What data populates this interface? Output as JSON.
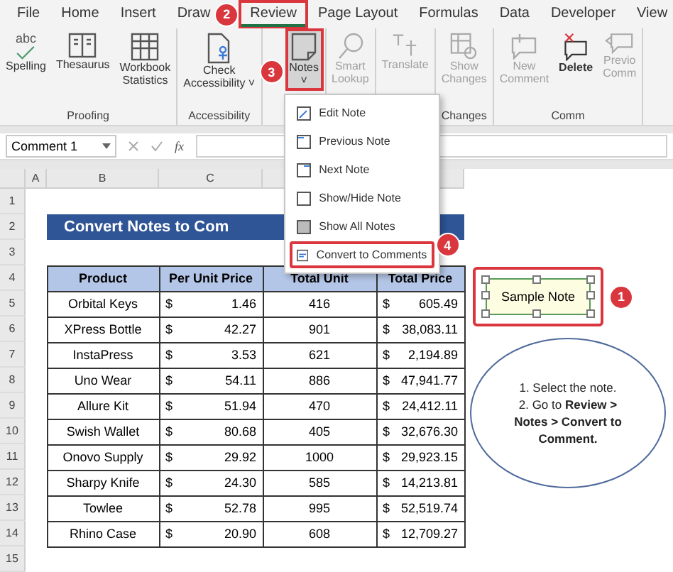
{
  "tabs": [
    {
      "label": "File",
      "selected": false,
      "highlighted": false
    },
    {
      "label": "Home",
      "selected": false,
      "highlighted": false
    },
    {
      "label": "Insert",
      "selected": false,
      "highlighted": false
    },
    {
      "label": "Draw",
      "selected": false,
      "highlighted": false
    },
    {
      "label": "Review",
      "selected": true,
      "highlighted": true,
      "callout": "2"
    },
    {
      "label": "Page Layout",
      "selected": false,
      "highlighted": false
    },
    {
      "label": "Formulas",
      "selected": false,
      "highlighted": false
    },
    {
      "label": "Data",
      "selected": false,
      "highlighted": false
    },
    {
      "label": "Developer",
      "selected": false,
      "highlighted": false
    },
    {
      "label": "View",
      "selected": false,
      "highlighted": false
    }
  ],
  "ribbon_groups": [
    {
      "label": "Proofing",
      "buttons": [
        {
          "icon_text": "abc",
          "lines": [
            "Spelling"
          ],
          "disabled": false,
          "highlighted": false
        },
        {
          "lines": [
            "Thesaurus"
          ],
          "disabled": false,
          "highlighted": false
        },
        {
          "lines": [
            "Workbook",
            "Statistics"
          ],
          "disabled": false,
          "highlighted": false
        }
      ]
    },
    {
      "label": "Accessibility",
      "buttons": [
        {
          "lines": [
            "Check",
            "Accessibility ˅"
          ],
          "disabled": false,
          "highlighted": false
        }
      ]
    },
    {
      "buttons": [
        {
          "lines": [
            "Notes",
            "˅"
          ],
          "disabled": false,
          "highlighted": true,
          "callout": "3",
          "menu": [
            {
              "label": "Edit Note",
              "highlighted": false
            },
            {
              "label": "Previous Note",
              "highlighted": false
            },
            {
              "label": "Next Note",
              "highlighted": false
            },
            {
              "label": "Show/Hide Note",
              "highlighted": false
            },
            {
              "label": "Show All Notes",
              "highlighted": false
            },
            {
              "label": "Convert to Comments",
              "highlighted": true,
              "callout": "4"
            }
          ]
        }
      ]
    },
    {
      "buttons": [
        {
          "lines": [
            "Smart",
            "Lookup"
          ],
          "disabled": true,
          "highlighted": false
        }
      ]
    },
    {
      "buttons": [
        {
          "lines": [
            "Translate"
          ],
          "disabled": true,
          "highlighted": false
        }
      ]
    },
    {
      "label": "Changes",
      "buttons": [
        {
          "lines": [
            "Show",
            "Changes"
          ],
          "disabled": true,
          "highlighted": false
        }
      ]
    },
    {
      "label": "Comm",
      "buttons": [
        {
          "lines": [
            "New",
            "Comment"
          ],
          "disabled": true,
          "highlighted": false
        },
        {
          "lines": [
            "Delete"
          ],
          "disabled": false,
          "highlighted": false
        },
        {
          "lines": [
            "Previo",
            "Comm"
          ],
          "disabled": true,
          "highlighted": false
        }
      ]
    }
  ],
  "formula_bar": {
    "name_box": "Comment 1",
    "function_label": "fx"
  },
  "column_headers": [
    "A",
    "B",
    "C"
  ],
  "row_headers": [
    "1",
    "2",
    "3",
    "4",
    "5",
    "6",
    "7",
    "8",
    "9",
    "10",
    "11",
    "12",
    "13",
    "14",
    "15"
  ],
  "sheet_title": "Convert Notes to Com",
  "table": {
    "columns": [
      "Product",
      "Per Unit Price",
      "Total Unit",
      "Total Price"
    ],
    "rows": [
      {
        "product": "Orbital Keys",
        "unit_price": "1.46",
        "total_unit": "416",
        "total_price": "605.49",
        "currency": "$",
        "currency_2": "$"
      },
      {
        "product": "XPress Bottle",
        "unit_price": "42.27",
        "total_unit": "901",
        "total_price": "38,083.11",
        "currency": "$",
        "currency_2": "$"
      },
      {
        "product": "InstaPress",
        "unit_price": "3.53",
        "total_unit": "621",
        "total_price": "2,194.89",
        "currency": "$",
        "currency_2": "$"
      },
      {
        "product": "Uno Wear",
        "unit_price": "54.11",
        "total_unit": "886",
        "total_price": "47,941.77",
        "currency": "$",
        "currency_2": "$"
      },
      {
        "product": "Allure Kit",
        "unit_price": "51.94",
        "total_unit": "470",
        "total_price": "24,412.11",
        "currency": "$",
        "currency_2": "$"
      },
      {
        "product": "Swish Wallet",
        "unit_price": "80.68",
        "total_unit": "405",
        "total_price": "32,676.30",
        "currency": "$",
        "currency_2": "$"
      },
      {
        "product": "Onovo Supply",
        "unit_price": "29.92",
        "total_unit": "1000",
        "total_price": "29,923.15",
        "currency": "$",
        "currency_2": "$"
      },
      {
        "product": "Sharpy Knife",
        "unit_price": "24.30",
        "total_unit": "585",
        "total_price": "14,213.81",
        "currency": "$",
        "currency_2": "$"
      },
      {
        "product": "Towlee",
        "unit_price": "52.78",
        "total_unit": "995",
        "total_price": "52,519.74",
        "currency": "$",
        "currency_2": "$"
      },
      {
        "product": "Rhino Case",
        "unit_price": "20.90",
        "total_unit": "608",
        "total_price": "12,709.27",
        "currency": "$",
        "currency_2": "$"
      }
    ]
  },
  "note": {
    "text": "Sample Note",
    "highlighted": true,
    "callout": "1"
  },
  "instructions": [
    "1. Select the note.",
    "2. Go to **Review >**",
    "**Notes > Convert to**",
    "**Comment.**"
  ]
}
